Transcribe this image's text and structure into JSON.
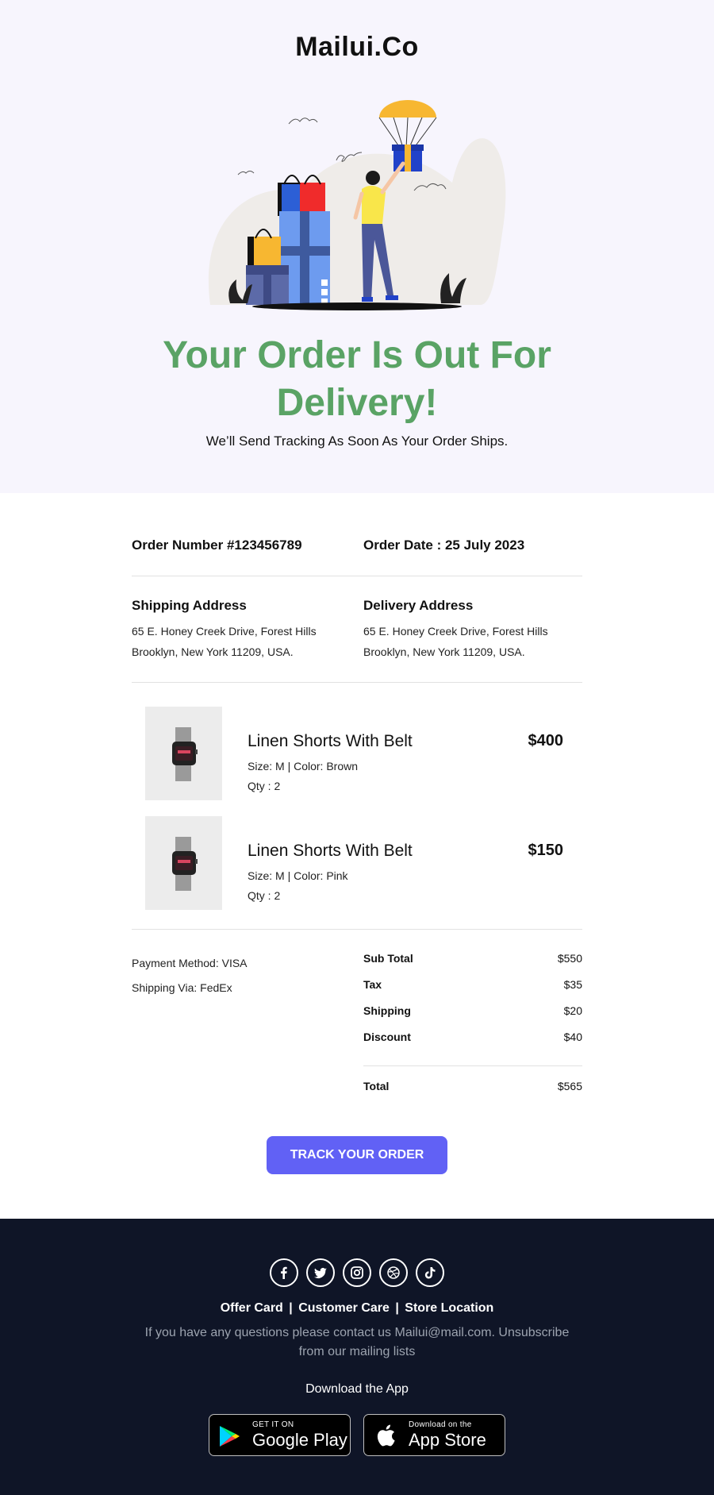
{
  "brand": "Mailui.Co",
  "hero": {
    "headline": "Your Order Is Out For Delivery!",
    "subline": "We’ll Send Tracking As Soon As Your Order Ships."
  },
  "order": {
    "number": "Order Number #123456789",
    "date": "Order Date : 25 July 2023"
  },
  "shipping": {
    "title": "Shipping Address",
    "line1": "65 E. Honey Creek Drive, Forest Hills",
    "line2": "Brooklyn, New York 11209, USA."
  },
  "delivery": {
    "title": "Delivery Address",
    "line1": "65 E. Honey Creek Drive, Forest Hills",
    "line2": "Brooklyn, New York 11209, USA."
  },
  "items": [
    {
      "name": "Linen Shorts With Belt",
      "price": "$400",
      "variant": "Size: M | Color: Brown",
      "qty": "Qty : 2"
    },
    {
      "name": "Linen Shorts With Belt",
      "price": "$150",
      "variant": "Size: M | Color: Pink",
      "qty": "Qty : 2"
    }
  ],
  "payment": {
    "method": "Payment Method: VISA",
    "via": "Shipping Via: FedEx"
  },
  "summary": {
    "subtotal_label": "Sub Total",
    "subtotal": "$550",
    "tax_label": "Tax",
    "tax": "$35",
    "shipping_label": "Shipping",
    "shipping": "$20",
    "discount_label": "Discount",
    "discount": "$40",
    "total_label": "Total",
    "total": "$565"
  },
  "cta": "TRACK YOUR ORDER",
  "footer": {
    "socials": [
      "facebook-icon",
      "twitter-icon",
      "instagram-icon",
      "dribbble-icon",
      "tiktok-icon"
    ],
    "link1": "Offer Card",
    "link2": "Customer Care",
    "link3": "Store Location",
    "separator": "|",
    "contact": "If you have any questions please contact us Mailui@mail.com. Unsubscribe from our mailing lists",
    "download": "Download the App",
    "google_small": "GET IT ON",
    "google_big": "Google Play",
    "apple_small": "Download on the",
    "apple_big": "App Store"
  },
  "colors": {
    "accent": "#6161f5",
    "headline": "#5aa365",
    "hero_bg": "#f7f5fd",
    "footer_bg": "#0f1527"
  }
}
